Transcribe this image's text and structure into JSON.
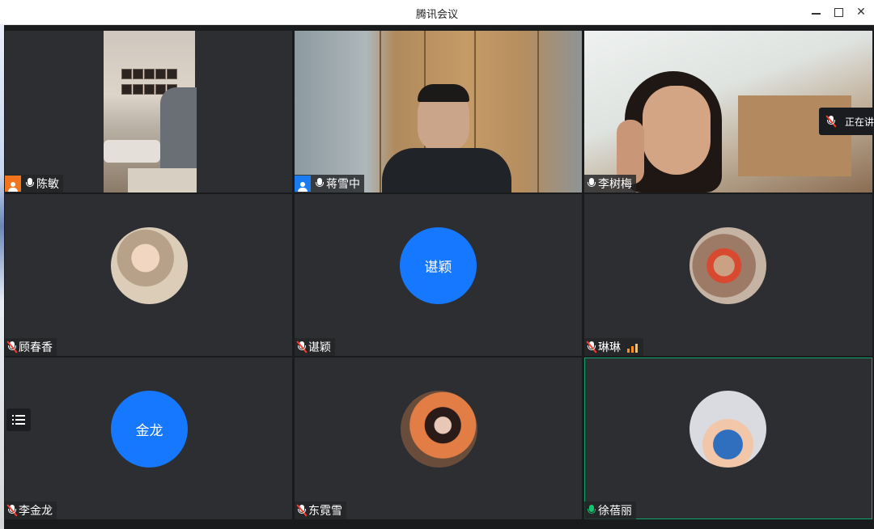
{
  "window": {
    "title": "腾讯会议",
    "minimize_glyph": "",
    "maximize_glyph": "",
    "close_glyph": "✕"
  },
  "participants": [
    {
      "name": "陈敏",
      "host_badge": "orange",
      "mic": "on",
      "view": "video"
    },
    {
      "name": "蒋雪中",
      "host_badge": "blue",
      "mic": "on",
      "view": "video"
    },
    {
      "name": "李树梅",
      "mic": "on",
      "view": "video"
    },
    {
      "name": "顾春香",
      "mic": "muted",
      "view": "photo",
      "photo": "baby"
    },
    {
      "name": "谌颖",
      "mic": "muted",
      "view": "text",
      "avatar_text": "谌颖"
    },
    {
      "name": "琳琳",
      "mic": "muted",
      "view": "photo",
      "photo": "hero",
      "signal": true
    },
    {
      "name": "李金龙",
      "mic": "muted",
      "view": "text",
      "avatar_text": "金龙"
    },
    {
      "name": "东霓雪",
      "mic": "muted",
      "view": "photo",
      "photo": "girl"
    },
    {
      "name": "徐蓓丽",
      "mic": "speaking",
      "view": "photo",
      "photo": "couple",
      "active": true
    }
  ],
  "speaking_indicator": {
    "label": "正在讲"
  },
  "icons": {
    "side_menu": "list-icon",
    "host": "user-icon",
    "mic": "microphone-icon",
    "mic_muted": "microphone-muted-icon",
    "signal": "signal-bars-icon"
  },
  "colors": {
    "tile_bg": "#2d2e31",
    "avatar_blue": "#1677ff",
    "host_orange": "#f1751d",
    "host_blue": "#1a7cf2",
    "speaking_green": "#15c36d",
    "active_border": "#12a46b"
  }
}
